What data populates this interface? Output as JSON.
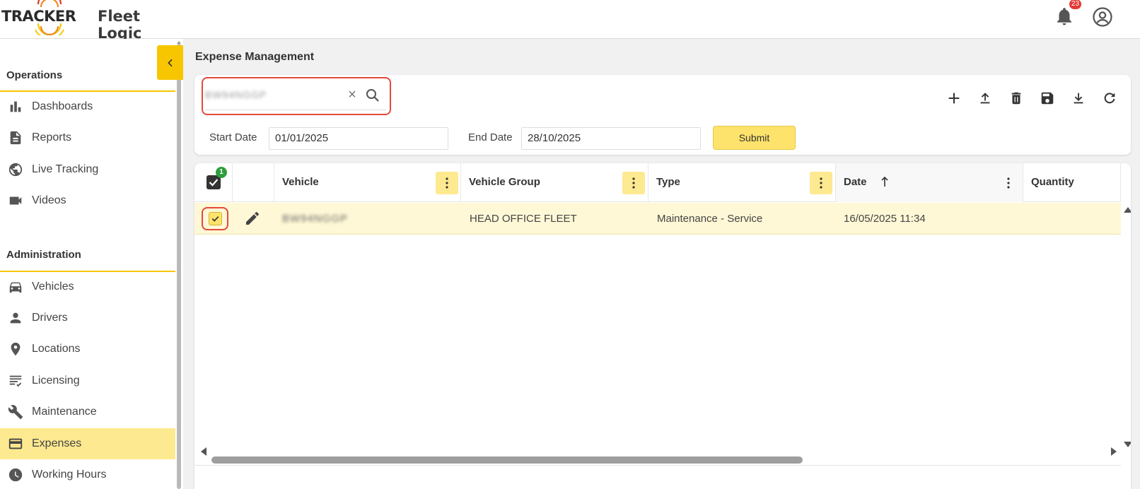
{
  "app": {
    "brand": "TRACKER",
    "product": "Fleet Logic",
    "notifications_count": "23"
  },
  "sidebar": {
    "sections": [
      {
        "title": "Operations",
        "items": [
          {
            "label": "Dashboards",
            "icon": "bar-chart-icon"
          },
          {
            "label": "Reports",
            "icon": "document-icon"
          },
          {
            "label": "Live Tracking",
            "icon": "globe-icon"
          },
          {
            "label": "Videos",
            "icon": "video-camera-icon"
          }
        ]
      },
      {
        "title": "Administration",
        "items": [
          {
            "label": "Vehicles",
            "icon": "car-icon"
          },
          {
            "label": "Drivers",
            "icon": "person-icon"
          },
          {
            "label": "Locations",
            "icon": "location-pin-icon"
          },
          {
            "label": "Licensing",
            "icon": "checklist-icon"
          },
          {
            "label": "Maintenance",
            "icon": "wrench-icon"
          },
          {
            "label": "Expenses",
            "icon": "credit-card-icon",
            "active": true
          },
          {
            "label": "Working Hours",
            "icon": "clock-icon"
          }
        ]
      }
    ]
  },
  "main": {
    "title": "Expense Management",
    "search": {
      "value": "BW94NGGP"
    },
    "toolbar": [
      "add-icon",
      "upload-icon",
      "delete-icon",
      "save-icon",
      "download-icon",
      "refresh-icon"
    ],
    "filters": {
      "start_label": "Start Date",
      "start_value": "01/01/2025",
      "end_label": "End Date",
      "end_value": "28/10/2025",
      "submit_label": "Submit"
    },
    "grid": {
      "selected_count": "1",
      "columns": [
        "Vehicle",
        "Vehicle Group",
        "Type",
        "Date",
        "Quantity"
      ],
      "sort": {
        "column": "Date",
        "direction": "ascending"
      },
      "rows": [
        {
          "vehicle": "BW94NGGP",
          "vehicle_group": "HEAD OFFICE FLEET",
          "type": "Maintenance - Service",
          "date": "16/05/2025 11:34",
          "quantity": "",
          "selected": true
        }
      ]
    }
  },
  "colors": {
    "accent": "#f7c600",
    "accent_light": "#fde98f",
    "highlight_outline": "#e34a3a",
    "badge_red": "#e53935",
    "badge_green": "#2e9e3c"
  }
}
